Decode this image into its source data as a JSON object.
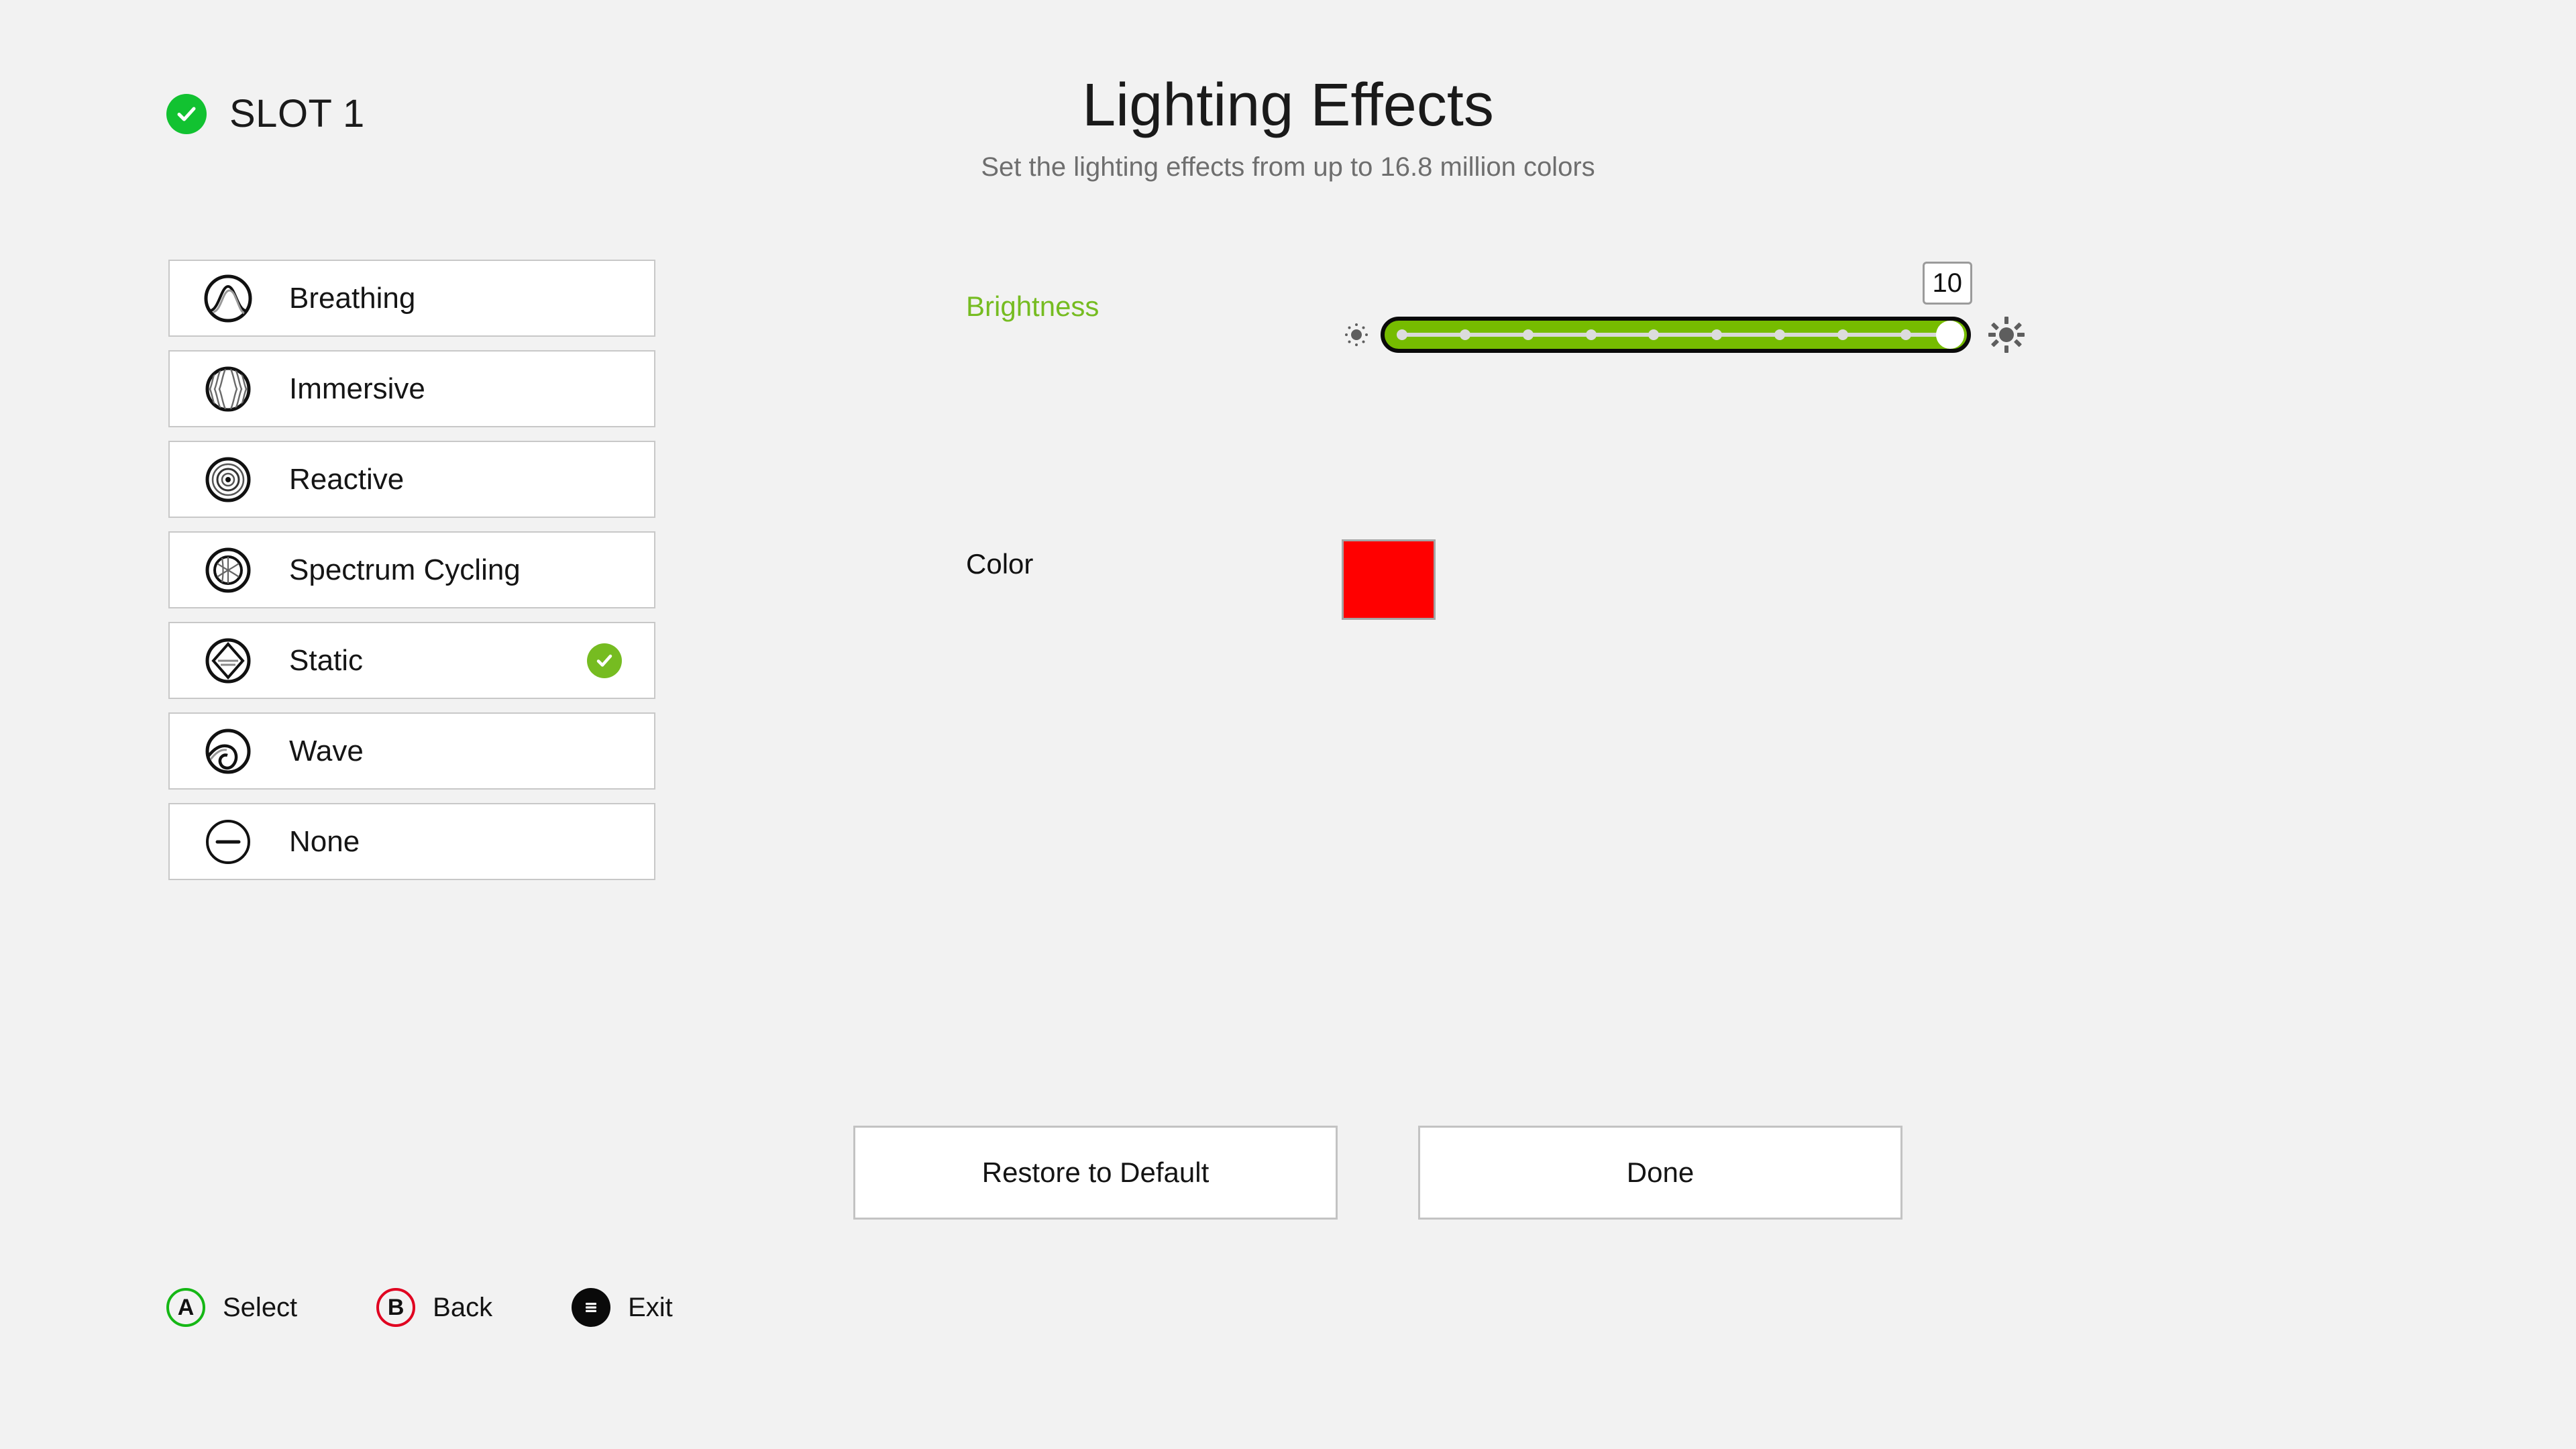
{
  "slot": {
    "title": "SLOT 1",
    "status_icon": "check-circle-icon",
    "status_color": "#12c231"
  },
  "header": {
    "title": "Lighting Effects",
    "subtitle": "Set the lighting effects from up to 16.8 million colors"
  },
  "effects": {
    "items": [
      {
        "label": "Breathing",
        "icon": "breathing-icon",
        "selected": false
      },
      {
        "label": "Immersive",
        "icon": "immersive-icon",
        "selected": false
      },
      {
        "label": "Reactive",
        "icon": "reactive-icon",
        "selected": false
      },
      {
        "label": "Spectrum Cycling",
        "icon": "spectrum-cycling-icon",
        "selected": false
      },
      {
        "label": "Static",
        "icon": "static-icon",
        "selected": true
      },
      {
        "label": "Wave",
        "icon": "wave-icon",
        "selected": false
      },
      {
        "label": "None",
        "icon": "none-icon",
        "selected": false
      }
    ],
    "selected_check_color": "#76bc21"
  },
  "settings": {
    "brightness": {
      "label": "Brightness",
      "label_color": "#76bc21",
      "value": "10",
      "min": "1",
      "max": "10",
      "tick_count": 9,
      "fill_color": "#76bc00",
      "low_icon": "sun-low-icon",
      "high_icon": "sun-high-icon"
    },
    "color": {
      "label": "Color",
      "swatch_color": "#ff0000"
    }
  },
  "footer": {
    "restore_label": "Restore to Default",
    "done_label": "Done"
  },
  "legend": {
    "items": [
      {
        "glyph": "A",
        "label": "Select",
        "icon": "button-a-icon",
        "color": "#15b715"
      },
      {
        "glyph": "B",
        "label": "Back",
        "icon": "button-b-icon",
        "color": "#e00020"
      },
      {
        "glyph": "",
        "label": "Exit",
        "icon": "button-menu-icon",
        "color": "#0a0a0a"
      }
    ]
  }
}
